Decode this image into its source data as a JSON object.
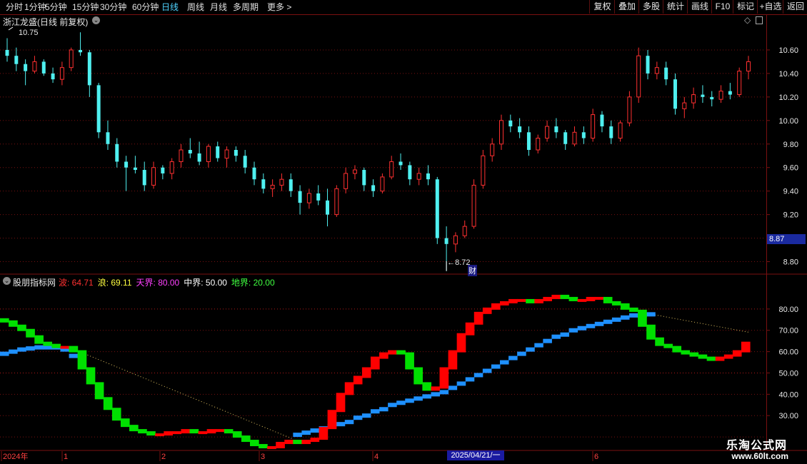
{
  "toolbar": {
    "periods": [
      "分时",
      "1分钟",
      "5分钟",
      "15分钟",
      "30分钟",
      "60分钟",
      "日线",
      "周线",
      "月线",
      "多周期",
      "更多 >"
    ],
    "active_period": "日线",
    "right_buttons": [
      "复权",
      "叠加",
      "多股",
      "统计",
      "画线",
      "F10",
      "标记",
      "+自选",
      "返回"
    ]
  },
  "price_panel": {
    "stock_title": "浙江龙盛(日线 前复权)",
    "y_ticks": [
      "10.60",
      "10.40",
      "10.20",
      "10.00",
      "9.80",
      "9.60",
      "9.40",
      "9.20",
      "9.00",
      "8.80"
    ],
    "current_price": "8.87",
    "high_label": "10.75",
    "low_label": "8.72",
    "finance_marker": "财"
  },
  "indicator_panel": {
    "name": "股朋指标网",
    "values": [
      {
        "label": "波:",
        "value": "64.71",
        "color": "#ff3030"
      },
      {
        "label": "浪:",
        "value": "69.11",
        "color": "#ffff40"
      },
      {
        "label": "天界:",
        "value": "80.00",
        "color": "#ff40ff"
      },
      {
        "label": "中界:",
        "value": "50.00",
        "color": "#ffffff"
      },
      {
        "label": "地界:",
        "value": "20.00",
        "color": "#40ff40"
      }
    ],
    "y_ticks": [
      "80.00",
      "70.00",
      "60.00",
      "50.00",
      "40.00",
      "30.00"
    ]
  },
  "x_axis": {
    "labels": [
      "2024年",
      "1",
      "2",
      "3",
      "4",
      "6"
    ],
    "highlight_date": "2025/04/21/一"
  },
  "watermark": {
    "line1": "乐淘公式网",
    "line2": "www.60lt.com"
  },
  "colors": {
    "up": "#ff3030",
    "down": "#4ff0f0",
    "wave_up": "#ff0000",
    "wave_down": "#00e000",
    "wave_blue": "#1e90ff",
    "grid": "#7a1010"
  },
  "chart_data": [
    {
      "type": "candlestick",
      "title": "浙江龙盛(日线 前复权)",
      "ylim": [
        8.7,
        10.8
      ],
      "series": [
        {
          "values": [
            [
              10.6,
              10.7,
              10.5,
              10.55
            ],
            [
              10.55,
              10.62,
              10.42,
              10.48
            ],
            [
              10.48,
              10.52,
              10.3,
              10.42
            ],
            [
              10.42,
              10.55,
              10.4,
              10.5
            ],
            [
              10.5,
              10.52,
              10.38,
              10.4
            ],
            [
              10.4,
              10.45,
              10.32,
              10.35
            ],
            [
              10.35,
              10.5,
              10.3,
              10.45
            ],
            [
              10.45,
              10.62,
              10.42,
              10.6
            ],
            [
              10.6,
              10.75,
              10.55,
              10.58
            ],
            [
              10.58,
              10.6,
              10.2,
              10.3
            ],
            [
              10.3,
              10.32,
              9.85,
              9.9
            ],
            [
              9.9,
              10.0,
              9.75,
              9.8
            ],
            [
              9.8,
              9.85,
              9.6,
              9.65
            ],
            [
              9.65,
              9.7,
              9.4,
              9.6
            ],
            [
              9.6,
              9.7,
              9.55,
              9.58
            ],
            [
              9.58,
              9.65,
              9.4,
              9.45
            ],
            [
              9.45,
              9.65,
              9.42,
              9.6
            ],
            [
              9.6,
              9.62,
              9.5,
              9.55
            ],
            [
              9.55,
              9.68,
              9.5,
              9.65
            ],
            [
              9.65,
              9.8,
              9.6,
              9.75
            ],
            [
              9.75,
              9.85,
              9.68,
              9.72
            ],
            [
              9.72,
              9.82,
              9.62,
              9.65
            ],
            [
              9.65,
              9.8,
              9.6,
              9.78
            ],
            [
              9.78,
              9.82,
              9.65,
              9.68
            ],
            [
              9.68,
              9.78,
              9.6,
              9.75
            ],
            [
              9.75,
              9.78,
              9.65,
              9.7
            ],
            [
              9.7,
              9.75,
              9.55,
              9.6
            ],
            [
              9.6,
              9.65,
              9.45,
              9.5
            ],
            [
              9.5,
              9.55,
              9.38,
              9.42
            ],
            [
              9.42,
              9.5,
              9.35,
              9.45
            ],
            [
              9.45,
              9.55,
              9.4,
              9.5
            ],
            [
              9.5,
              9.55,
              9.35,
              9.4
            ],
            [
              9.4,
              9.45,
              9.2,
              9.3
            ],
            [
              9.3,
              9.42,
              9.25,
              9.38
            ],
            [
              9.38,
              9.45,
              9.28,
              9.32
            ],
            [
              9.32,
              9.42,
              9.1,
              9.2
            ],
            [
              9.2,
              9.45,
              9.18,
              9.42
            ],
            [
              9.42,
              9.6,
              9.38,
              9.55
            ],
            [
              9.55,
              9.62,
              9.5,
              9.58
            ],
            [
              9.58,
              9.6,
              9.4,
              9.45
            ],
            [
              9.45,
              9.5,
              9.35,
              9.4
            ],
            [
              9.4,
              9.55,
              9.38,
              9.52
            ],
            [
              9.52,
              9.7,
              9.5,
              9.65
            ],
            [
              9.65,
              9.72,
              9.58,
              9.62
            ],
            [
              9.62,
              9.65,
              9.45,
              9.5
            ],
            [
              9.5,
              9.6,
              9.45,
              9.55
            ],
            [
              9.55,
              9.62,
              9.45,
              9.5
            ],
            [
              9.5,
              9.52,
              8.95,
              9.0
            ],
            [
              9.0,
              9.1,
              8.72,
              8.95
            ],
            [
              8.95,
              9.05,
              8.88,
              9.02
            ],
            [
              9.02,
              9.15,
              9.0,
              9.1
            ],
            [
              9.1,
              9.5,
              9.08,
              9.45
            ],
            [
              9.45,
              9.75,
              9.42,
              9.7
            ],
            [
              9.7,
              9.85,
              9.65,
              9.8
            ],
            [
              9.8,
              10.05,
              9.75,
              10.0
            ],
            [
              10.0,
              10.05,
              9.9,
              9.95
            ],
            [
              9.95,
              10.02,
              9.85,
              9.9
            ],
            [
              9.9,
              9.95,
              9.7,
              9.75
            ],
            [
              9.75,
              9.88,
              9.72,
              9.85
            ],
            [
              9.85,
              10.0,
              9.82,
              9.95
            ],
            [
              9.95,
              10.02,
              9.85,
              9.9
            ],
            [
              9.9,
              9.92,
              9.75,
              9.8
            ],
            [
              9.8,
              9.95,
              9.78,
              9.9
            ],
            [
              9.9,
              9.95,
              9.8,
              9.85
            ],
            [
              9.85,
              10.1,
              9.82,
              10.05
            ],
            [
              10.05,
              10.08,
              9.9,
              9.95
            ],
            [
              9.95,
              10.0,
              9.8,
              9.85
            ],
            [
              9.85,
              10.0,
              9.82,
              9.98
            ],
            [
              9.98,
              10.25,
              9.95,
              10.2
            ],
            [
              10.2,
              10.62,
              10.15,
              10.55
            ],
            [
              10.55,
              10.6,
              10.35,
              10.4
            ],
            [
              10.4,
              10.5,
              10.35,
              10.45
            ],
            [
              10.45,
              10.5,
              10.3,
              10.35
            ],
            [
              10.35,
              10.4,
              10.05,
              10.1
            ],
            [
              10.1,
              10.2,
              10.02,
              10.15
            ],
            [
              10.15,
              10.28,
              10.1,
              10.22
            ],
            [
              10.22,
              10.3,
              10.15,
              10.2
            ],
            [
              10.2,
              10.25,
              10.12,
              10.18
            ],
            [
              10.18,
              10.3,
              10.15,
              10.25
            ],
            [
              10.25,
              10.32,
              10.18,
              10.22
            ],
            [
              10.22,
              10.45,
              10.2,
              10.42
            ],
            [
              10.42,
              10.55,
              10.35,
              10.5
            ]
          ]
        }
      ]
    },
    {
      "type": "line",
      "title": "股朋指标网",
      "ylim": [
        14,
        90
      ],
      "series": [
        {
          "name": "波",
          "values": [
            75,
            74,
            72,
            70,
            67,
            64,
            63,
            62,
            62,
            60,
            52,
            45,
            38,
            33,
            28,
            25,
            23,
            22,
            21,
            21,
            22,
            22,
            23,
            22,
            22,
            23,
            23,
            22,
            20,
            18,
            16,
            15,
            15,
            17,
            18,
            17,
            18,
            19,
            24,
            32,
            40,
            45,
            48,
            52,
            57,
            59,
            60,
            59,
            52,
            45,
            42,
            43,
            52,
            60,
            68,
            73,
            78,
            80,
            82,
            83,
            84,
            84,
            83,
            84,
            85,
            86,
            85,
            84,
            84,
            85,
            85,
            83,
            82,
            80,
            79,
            72,
            66,
            63,
            62,
            60,
            59,
            58,
            57,
            56,
            57,
            58,
            60,
            64
          ]
        },
        {
          "name": "浪",
          "values": [
            59,
            60,
            61,
            61.5,
            62,
            62,
            62,
            61,
            58,
            55,
            52,
            49,
            46,
            43,
            40,
            37,
            35,
            33,
            31,
            29,
            27,
            25,
            24,
            23,
            22,
            21,
            20,
            20,
            20,
            19,
            19,
            19,
            20,
            20,
            21,
            22,
            23,
            24,
            25,
            26,
            27,
            29,
            30,
            32,
            33,
            35,
            36,
            37,
            38,
            39,
            40,
            41,
            43,
            45,
            47,
            49,
            51,
            53,
            55,
            57,
            59,
            61,
            63,
            65,
            67,
            68,
            70,
            71,
            72,
            73,
            74,
            75,
            76,
            77,
            77,
            77.5,
            78,
            77,
            76,
            75,
            74,
            73,
            72,
            71,
            70,
            69.5,
            69,
            69
          ]
        }
      ]
    }
  ]
}
